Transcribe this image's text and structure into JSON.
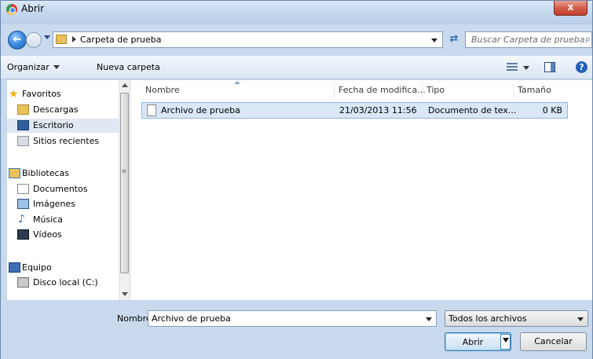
{
  "window": {
    "title": "Abrir",
    "close_symbol": "x"
  },
  "address": {
    "path": "Carpeta de prueba",
    "search_placeholder": "Buscar Carpeta de prueba"
  },
  "toolbar": {
    "organize": "Organizar",
    "new_folder": "Nueva carpeta",
    "help_symbol": "?"
  },
  "sidebar": {
    "favorites": "Favoritos",
    "downloads": "Descargas",
    "desktop": "Escritorio",
    "recent": "Sitios recientes",
    "libraries": "Bibliotecas",
    "documents": "Documentos",
    "pictures": "Imágenes",
    "music": "Música",
    "videos": "Vídeos",
    "computer": "Equipo",
    "local_disk": "Disco local (C:)"
  },
  "columns": {
    "name": "Nombre",
    "date": "Fecha de modifica...",
    "type": "Tipo",
    "size": "Tamaño"
  },
  "files": [
    {
      "name": "Archivo de prueba",
      "date": "21/03/2013 11:56",
      "type": "Documento de tex...",
      "size": "0 KB"
    }
  ],
  "bottom": {
    "name_label": "Nombre:",
    "name_value": "Archivo de prueba",
    "filter": "Todos los archivos",
    "open": "Abrir",
    "cancel": "Cancelar"
  },
  "colors": {
    "selection": "#d9e7f7",
    "chrome": "#c9d9ee",
    "accent": "#3c7fb1"
  }
}
